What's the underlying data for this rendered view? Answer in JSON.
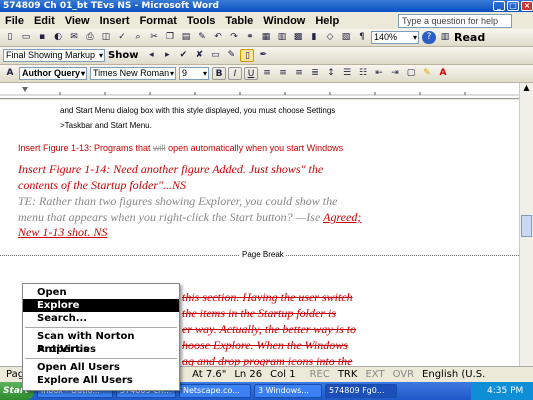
{
  "window": {
    "title": "574809 Ch 01_bt TEvs NS - Microsoft Word"
  },
  "menu": {
    "items": [
      "File",
      "Edit",
      "View",
      "Insert",
      "Format",
      "Tools",
      "Table",
      "Window",
      "Help"
    ],
    "help_placeholder": "Type a question for help"
  },
  "toolbar1": {
    "zoom": "140%",
    "read_label": "Read"
  },
  "toolbar2": {
    "markup": "Final Showing Markup",
    "show_label": "Show"
  },
  "toolbar3": {
    "style": "Author Query",
    "font": "Times New Roman",
    "size": "9",
    "bold": "B",
    "italic": "I",
    "underline": "U"
  },
  "doc": {
    "line1": "and Start Menu dialog box with this style displayed, you must choose Settings",
    "line2": ">Taskbar and Start Menu.",
    "fig_caption_pre": "Insert Figure 1-13: Programs that ",
    "fig_caption_del": "will",
    "fig_caption_post": " open automatically when you start Windows",
    "note1a": "Insert Figure 1-14: Need another figure Added. Just shows\" the",
    "note1b": "contents of the Startup folder\"...NS",
    "note2a": "TE: Rather than two figures showing Explorer, you could show the",
    "note2b": "menu that appears when you right-click the Start button? ",
    "note2c": "—Ise",
    "note2d": "Agreed;",
    "note2e": "New 1-13 shot. NS",
    "page_break": "Page Break",
    "strike1": "this section. Having the user switch",
    "strike2": "the items in the Startup folder is",
    "strike3": "er way. Actually, the better way is to",
    "strike4": "hoose Explore. When the Windows",
    "strike5": "ag and drop program icons into the"
  },
  "context_menu": {
    "items": [
      "Open",
      "Explore",
      "Search...",
      "Scan with Norton AntiVirus",
      "Properties",
      "Open All Users",
      "Explore All Users"
    ]
  },
  "status": {
    "page": "Pag",
    "at": "At 7.6\"",
    "ln": "Ln 26",
    "col": "Col 1",
    "rec": "REC",
    "trk": "TRK",
    "ext": "EXT",
    "ovr": "OVR",
    "lang": "English (U.S."
  },
  "taskbar": {
    "start": "Start",
    "tasks": [
      "Inbox - Outlo...",
      "574809 Ch...",
      "Netscape.co...",
      "3 Windows...",
      "574809 Fg0..."
    ],
    "clock": "4:35 PM"
  }
}
